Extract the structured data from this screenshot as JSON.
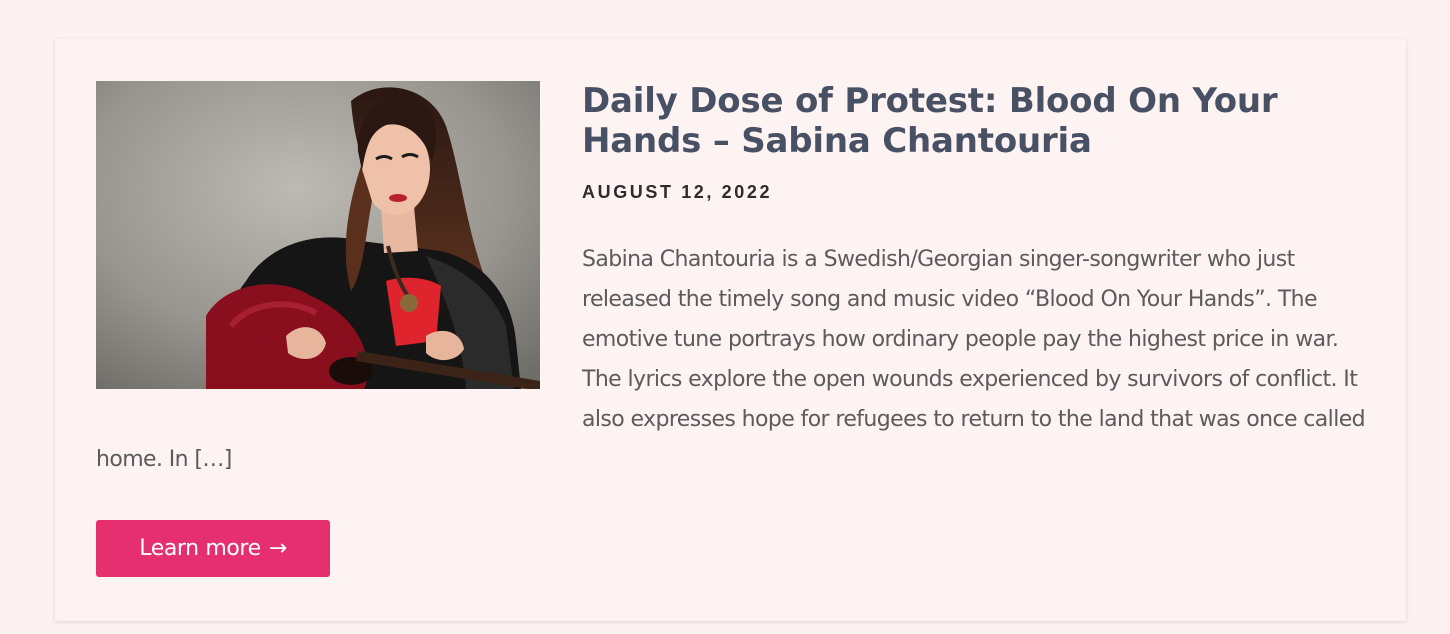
{
  "post": {
    "title": "Daily Dose of Protest: Blood On Your Hands – Sabina Chantouria",
    "date": "AUGUST 12, 2022",
    "excerpt": "Sabina Chantouria is a Swedish/Georgian singer-songwriter who just released the timely song and music video “Blood On Your Hands”. The emotive tune portrays how ordinary people pay the highest price in war. The lyrics explore the open wounds experienced by survivors of conflict. It also expresses hope for refugees to return to the land that was once called home. In […]",
    "button_label": "Learn more",
    "button_icon": "arrow-right-icon",
    "button_arrow": "→",
    "image_subject": "woman-with-red-guitar"
  },
  "colors": {
    "background": "#fdf2f1",
    "card": "#fdf3f2",
    "title": "#485063",
    "date": "#2c2c2c",
    "excerpt": "#5b5b5b",
    "accent": "#e52f6f"
  }
}
